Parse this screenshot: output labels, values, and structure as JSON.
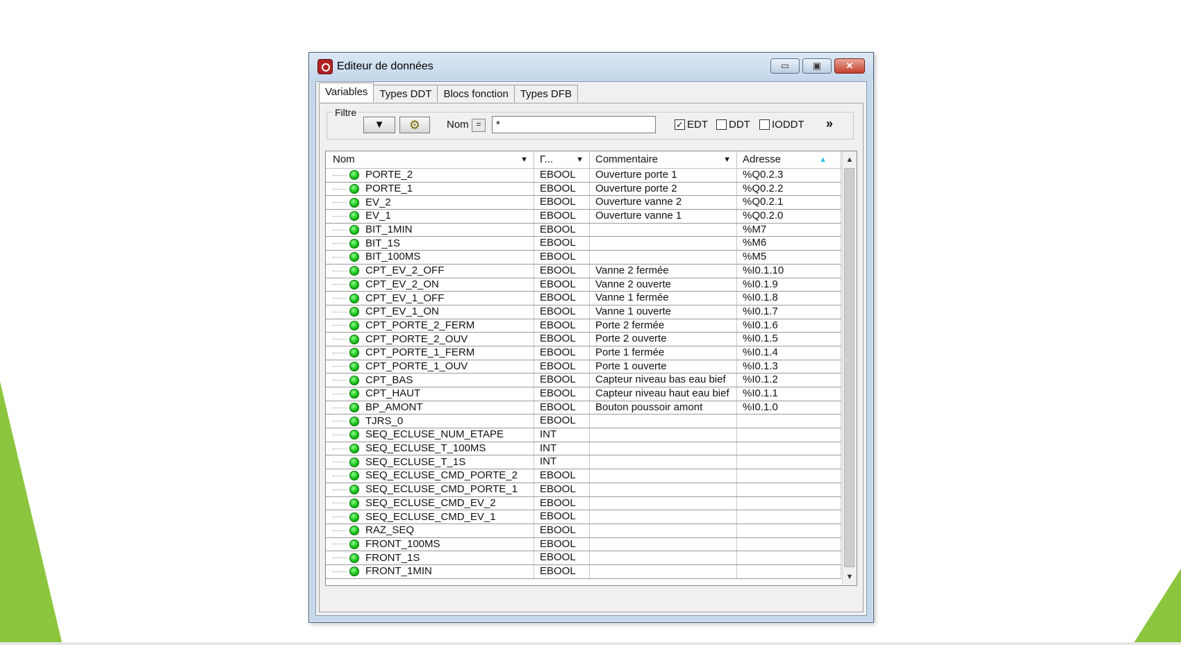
{
  "window": {
    "title": "Editeur de données",
    "min_label": "▭",
    "max_label": "▣",
    "close_label": "✕"
  },
  "tabs": [
    "Variables",
    "Types DDT",
    "Blocs fonction",
    "Types DFB"
  ],
  "filter": {
    "legend": "Filtre",
    "name_label": "Nom",
    "operator": "=",
    "name_value": "*",
    "checkboxes": [
      {
        "label": "EDT",
        "checked": true
      },
      {
        "label": "DDT",
        "checked": false
      },
      {
        "label": "IODDT",
        "checked": false
      }
    ],
    "more_label": "»"
  },
  "columns": [
    "Nom",
    "Γ...",
    "Commentaire",
    "Adresse"
  ],
  "rows": [
    {
      "name": "PORTE_2",
      "type": "EBOOL",
      "comment": "Ouverture porte 1",
      "address": "%Q0.2.3"
    },
    {
      "name": "PORTE_1",
      "type": "EBOOL",
      "comment": "Ouverture porte 2",
      "address": "%Q0.2.2"
    },
    {
      "name": "EV_2",
      "type": "EBOOL",
      "comment": "Ouverture vanne 2",
      "address": "%Q0.2.1"
    },
    {
      "name": "EV_1",
      "type": "EBOOL",
      "comment": "Ouverture vanne 1",
      "address": "%Q0.2.0"
    },
    {
      "name": "BIT_1MIN",
      "type": "EBOOL",
      "comment": "",
      "address": "%M7"
    },
    {
      "name": "BIT_1S",
      "type": "EBOOL",
      "comment": "",
      "address": "%M6"
    },
    {
      "name": "BIT_100MS",
      "type": "EBOOL",
      "comment": "",
      "address": "%M5"
    },
    {
      "name": "CPT_EV_2_OFF",
      "type": "EBOOL",
      "comment": "Vanne 2 fermée",
      "address": "%I0.1.10"
    },
    {
      "name": "CPT_EV_2_ON",
      "type": "EBOOL",
      "comment": "Vanne 2 ouverte",
      "address": "%I0.1.9"
    },
    {
      "name": "CPT_EV_1_OFF",
      "type": "EBOOL",
      "comment": "Vanne 1 fermée",
      "address": "%I0.1.8"
    },
    {
      "name": "CPT_EV_1_ON",
      "type": "EBOOL",
      "comment": "Vanne 1 ouverte",
      "address": "%I0.1.7"
    },
    {
      "name": "CPT_PORTE_2_FERM",
      "type": "EBOOL",
      "comment": "Porte 2 fermée",
      "address": "%I0.1.6"
    },
    {
      "name": "CPT_PORTE_2_OUV",
      "type": "EBOOL",
      "comment": "Porte 2 ouverte",
      "address": "%I0.1.5"
    },
    {
      "name": "CPT_PORTE_1_FERM",
      "type": "EBOOL",
      "comment": "Porte 1 fermée",
      "address": "%I0.1.4"
    },
    {
      "name": "CPT_PORTE_1_OUV",
      "type": "EBOOL",
      "comment": "Porte 1 ouverte",
      "address": "%I0.1.3"
    },
    {
      "name": "CPT_BAS",
      "type": "EBOOL",
      "comment": "Capteur niveau bas eau bief",
      "address": "%I0.1.2"
    },
    {
      "name": "CPT_HAUT",
      "type": "EBOOL",
      "comment": "Capteur niveau haut eau bief",
      "address": "%I0.1.1"
    },
    {
      "name": "BP_AMONT",
      "type": "EBOOL",
      "comment": "Bouton poussoir amont",
      "address": "%I0.1.0"
    },
    {
      "name": "TJRS_0",
      "type": "EBOOL",
      "comment": "",
      "address": ""
    },
    {
      "name": "SEQ_ECLUSE_NUM_ETAPE",
      "type": "INT",
      "comment": "",
      "address": ""
    },
    {
      "name": "SEQ_ECLUSE_T_100MS",
      "type": "INT",
      "comment": "",
      "address": ""
    },
    {
      "name": "SEQ_ECLUSE_T_1S",
      "type": "INT",
      "comment": "",
      "address": ""
    },
    {
      "name": "SEQ_ECLUSE_CMD_PORTE_2",
      "type": "EBOOL",
      "comment": "",
      "address": ""
    },
    {
      "name": "SEQ_ECLUSE_CMD_PORTE_1",
      "type": "EBOOL",
      "comment": "",
      "address": ""
    },
    {
      "name": "SEQ_ECLUSE_CMD_EV_2",
      "type": "EBOOL",
      "comment": "",
      "address": ""
    },
    {
      "name": "SEQ_ECLUSE_CMD_EV_1",
      "type": "EBOOL",
      "comment": "",
      "address": ""
    },
    {
      "name": "RAZ_SEQ",
      "type": "EBOOL",
      "comment": "",
      "address": ""
    },
    {
      "name": "FRONT_100MS",
      "type": "EBOOL",
      "comment": "",
      "address": ""
    },
    {
      "name": "FRONT_1S",
      "type": "EBOOL",
      "comment": "",
      "address": ""
    },
    {
      "name": "FRONT_1MIN",
      "type": "EBOOL",
      "comment": "",
      "address": ""
    }
  ],
  "icons": {
    "row_status": "green-dot-icon",
    "filter": "funnel-icon",
    "tool": "gear-icon"
  },
  "colors": {
    "accent_green": "#8cc63e",
    "status_green": "#19c219"
  }
}
